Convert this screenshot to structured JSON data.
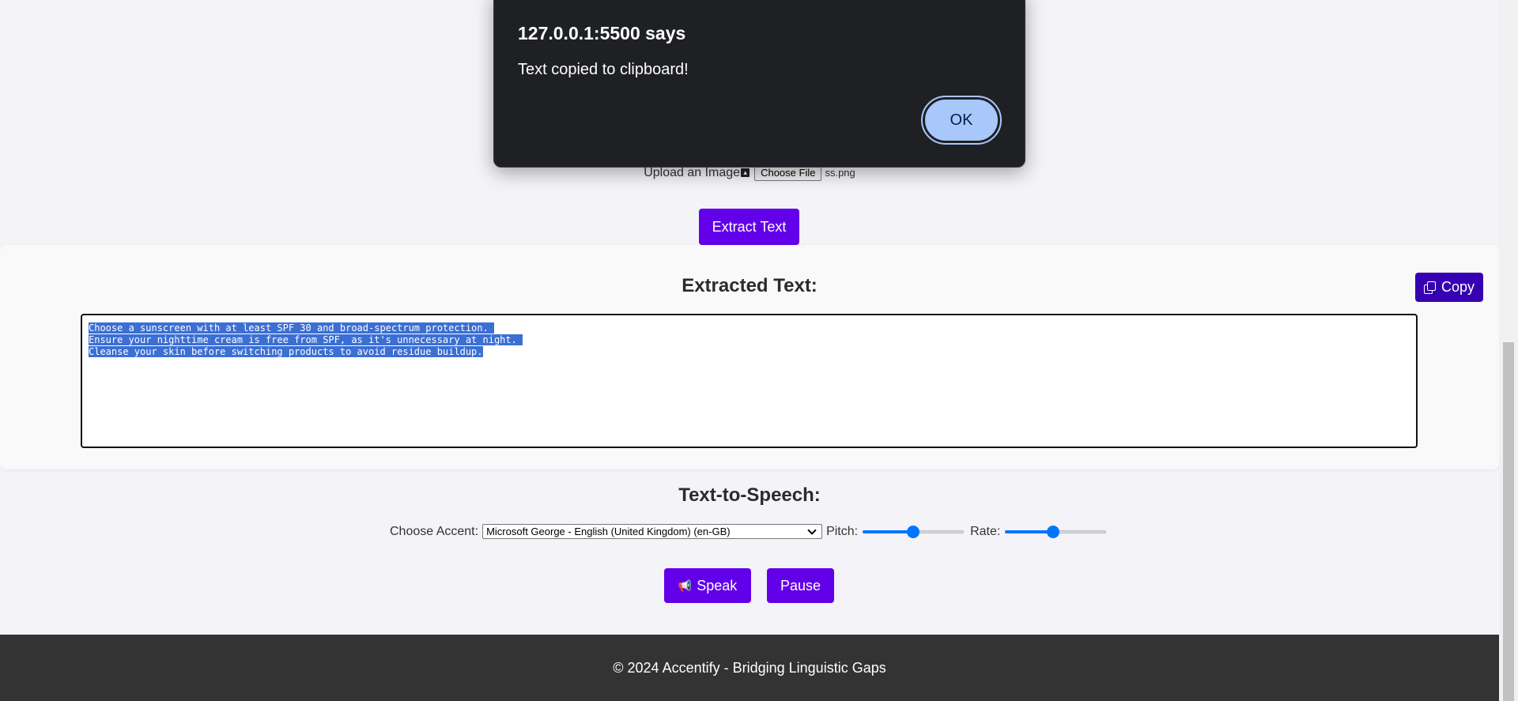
{
  "dialog": {
    "title": "127.0.0.1:5500 says",
    "message": "Text copied to clipboard!",
    "ok_label": "OK"
  },
  "upload": {
    "label": "Upload an Image",
    "icon": "upload-icon",
    "choose_file_label": "Choose File",
    "file_name": "ss.png"
  },
  "extract_button": "Extract Text",
  "extracted": {
    "title": "Extracted Text:",
    "copy_label": "Copy",
    "lines": [
      "Choose a sunscreen with at least SPF 30 and broad-spectrum protection. ",
      "Ensure your nighttime cream is free from SPF, as it's unnecessary at night. ",
      "Cleanse your skin before switching products to avoid residue buildup."
    ]
  },
  "tts": {
    "title": "Text-to-Speech:",
    "accent_label": "Choose Accent:",
    "accent_value": "Microsoft George - English (United Kingdom) (en-GB)",
    "pitch_label": "Pitch:",
    "pitch_value": 0.5,
    "rate_label": "Rate:",
    "rate_value": 0.47,
    "speak_label": "Speak",
    "pause_label": "Pause"
  },
  "footer": {
    "text": "© 2024 Accentify - Bridging Linguistic Gaps"
  },
  "colors": {
    "primary": "#6200ea",
    "copy_button": "#3700b3",
    "footer_bg": "#333333",
    "selection": "#3b6fd4",
    "dialog_bg": "#1f2023",
    "dialog_ok": "#a8c7fa"
  }
}
